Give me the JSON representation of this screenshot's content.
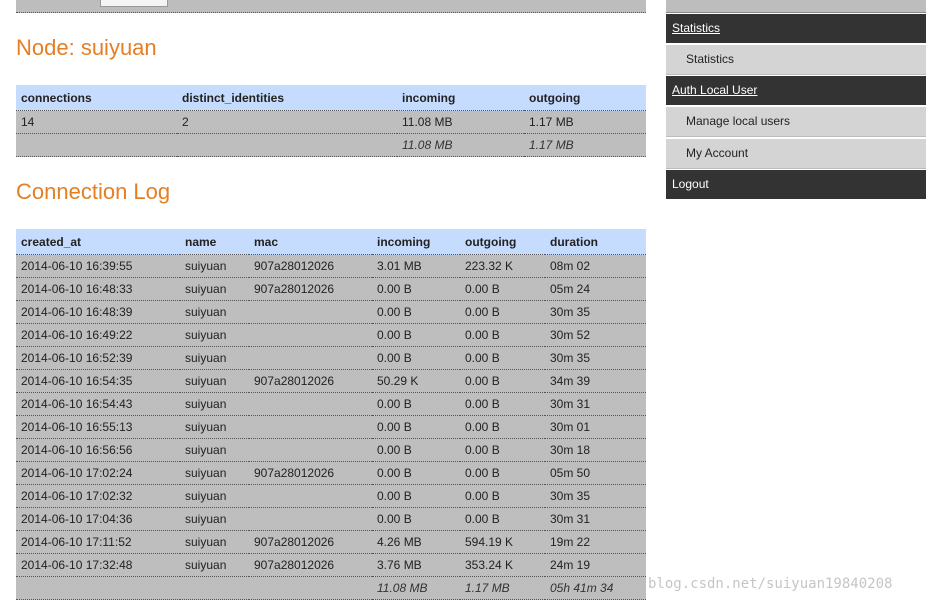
{
  "node": {
    "title": "Node: suiyuan",
    "columns": [
      "connections",
      "distinct_identities",
      "incoming",
      "outgoing"
    ],
    "row": [
      "14",
      "2",
      "11.08 MB",
      "1.17 MB"
    ],
    "total": [
      "",
      "",
      "11.08 MB",
      "1.17 MB"
    ]
  },
  "log": {
    "title": "Connection Log",
    "columns": [
      "created_at",
      "name",
      "mac",
      "incoming",
      "outgoing",
      "duration"
    ],
    "rows": [
      [
        "2014-06-10 16:39:55",
        "suiyuan",
        "907a28012026",
        "3.01 MB",
        "223.32 K",
        "08m 02"
      ],
      [
        "2014-06-10 16:48:33",
        "suiyuan",
        "907a28012026",
        "0.00 B",
        "0.00 B",
        "05m 24"
      ],
      [
        "2014-06-10 16:48:39",
        "suiyuan",
        "",
        "0.00 B",
        "0.00 B",
        "30m 35"
      ],
      [
        "2014-06-10 16:49:22",
        "suiyuan",
        "",
        "0.00 B",
        "0.00 B",
        "30m 52"
      ],
      [
        "2014-06-10 16:52:39",
        "suiyuan",
        "",
        "0.00 B",
        "0.00 B",
        "30m 35"
      ],
      [
        "2014-06-10 16:54:35",
        "suiyuan",
        "907a28012026",
        "50.29 K",
        "0.00 B",
        "34m 39"
      ],
      [
        "2014-06-10 16:54:43",
        "suiyuan",
        "",
        "0.00 B",
        "0.00 B",
        "30m 31"
      ],
      [
        "2014-06-10 16:55:13",
        "suiyuan",
        "",
        "0.00 B",
        "0.00 B",
        "30m 01"
      ],
      [
        "2014-06-10 16:56:56",
        "suiyuan",
        "",
        "0.00 B",
        "0.00 B",
        "30m 18"
      ],
      [
        "2014-06-10 17:02:24",
        "suiyuan",
        "907a28012026",
        "0.00 B",
        "0.00 B",
        "05m 50"
      ],
      [
        "2014-06-10 17:02:32",
        "suiyuan",
        "",
        "0.00 B",
        "0.00 B",
        "30m 35"
      ],
      [
        "2014-06-10 17:04:36",
        "suiyuan",
        "",
        "0.00 B",
        "0.00 B",
        "30m 31"
      ],
      [
        "2014-06-10 17:11:52",
        "suiyuan",
        "907a28012026",
        "4.26 MB",
        "594.19 K",
        "19m 22"
      ],
      [
        "2014-06-10 17:32:48",
        "suiyuan",
        "907a28012026",
        "3.76 MB",
        "353.24 K",
        "24m 19"
      ]
    ],
    "total": [
      "",
      "",
      "",
      "11.08 MB",
      "1.17 MB",
      "05h 41m 34"
    ]
  },
  "sidebar": {
    "sections": [
      {
        "header": "Statistics",
        "link": true,
        "items": [
          "Statistics"
        ]
      },
      {
        "header": "Auth Local User",
        "link": true,
        "items": [
          "Manage local users",
          "My Account"
        ]
      },
      {
        "header": "Logout",
        "link": false,
        "items": []
      }
    ]
  },
  "watermark": "blog.csdn.net/suiyuan19840208",
  "colors": {
    "accent": "#e67e22",
    "table_header": "#c5dcff",
    "table_row": "#bebebe",
    "sidebar_header": "#333333",
    "sidebar_item": "#d4d4d4"
  }
}
